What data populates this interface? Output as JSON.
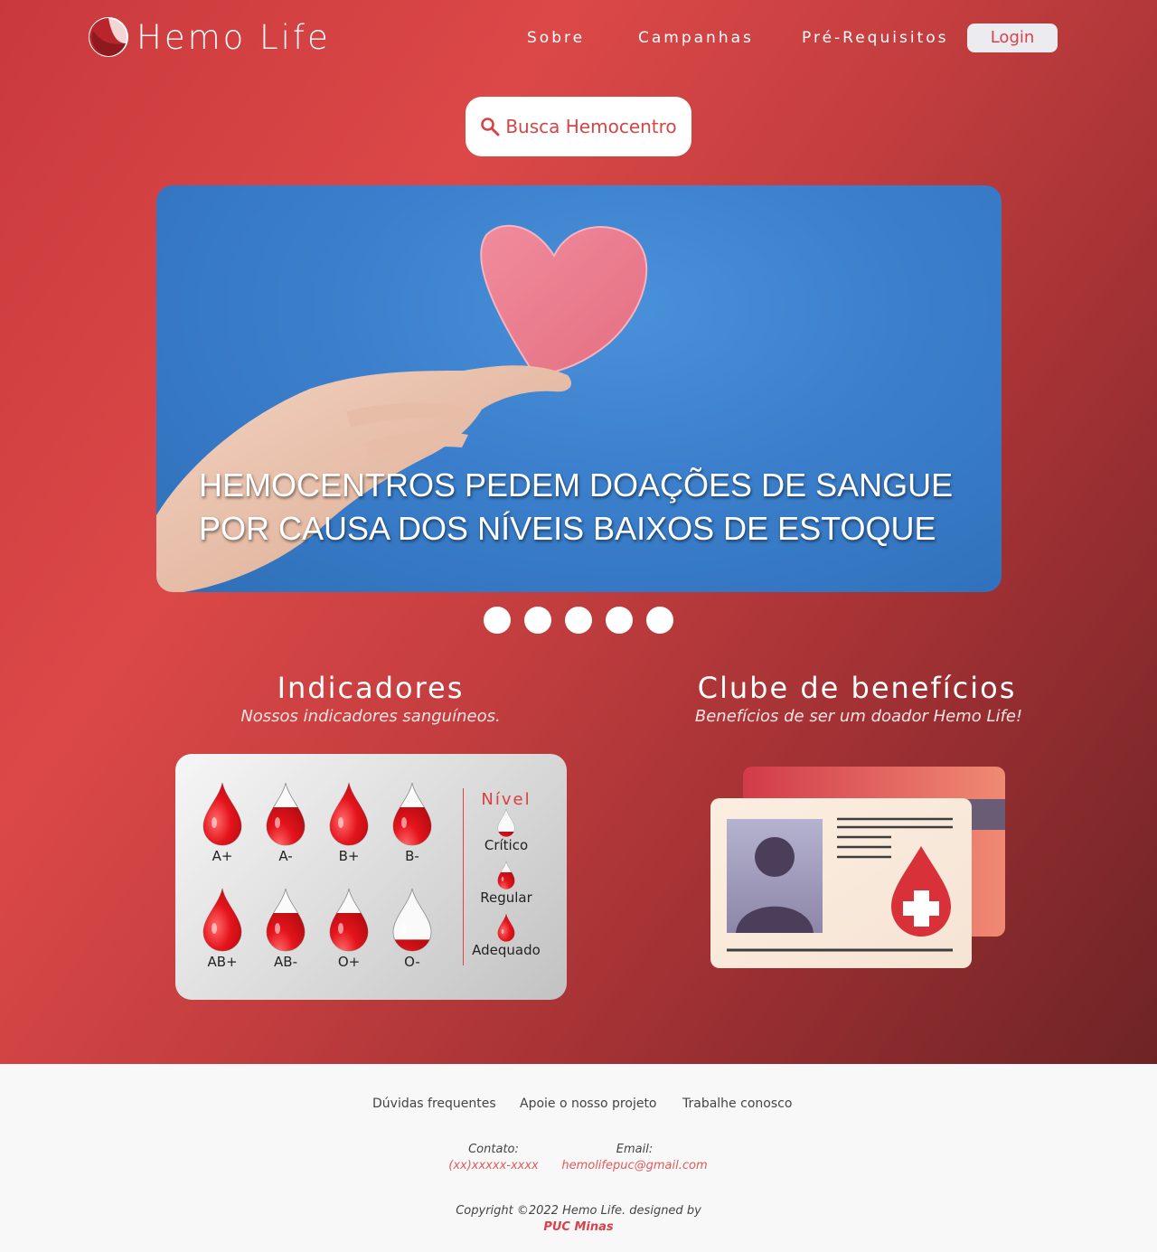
{
  "header": {
    "logo_text": "Hemo Life",
    "nav": [
      "Sobre",
      "Campanhas",
      "Pré-Requisitos"
    ],
    "login_label": "Login"
  },
  "search": {
    "label": "Busca Hemocentro",
    "icon": "search-icon"
  },
  "banner": {
    "headline_line1": "HEMOCENTROS PEDEM DOAÇÕES DE SANGUE",
    "headline_line2": "POR CAUSA DOS NÍVEIS BAIXOS DE ESTOQUE",
    "slide_count": 5
  },
  "indicators": {
    "title": "Indicadores",
    "subtitle": "Nossos indicadores sanguíneos.",
    "types": [
      {
        "label": "A+",
        "level": "Adequado"
      },
      {
        "label": "A-",
        "level": "Regular"
      },
      {
        "label": "B+",
        "level": "Adequado"
      },
      {
        "label": "B-",
        "level": "Regular"
      },
      {
        "label": "AB+",
        "level": "Adequado"
      },
      {
        "label": "AB-",
        "level": "Regular"
      },
      {
        "label": "O+",
        "level": "Regular"
      },
      {
        "label": "O-",
        "level": "Crítico"
      }
    ],
    "legend_title": "Nível",
    "legend": [
      "Crítico",
      "Regular",
      "Adequado"
    ]
  },
  "benefits": {
    "title": "Clube de benefícios",
    "subtitle": "Benefícios de ser um doador Hemo Life!"
  },
  "footer": {
    "links": [
      "Dúvidas frequentes",
      "Apoie o nosso projeto",
      "Trabalhe conosco"
    ],
    "contact_label": "Contato:",
    "contact_value": "(xx)xxxxx-xxxx",
    "email_label": "Email:",
    "email_value": "hemolifepuc@gmail.com",
    "copyright": "Copyright ©2022 Hemo Life. designed by",
    "designer": "PUC Minas"
  },
  "colors": {
    "brand_red": "#d54546",
    "accent_blue": "#3b7fcc"
  }
}
